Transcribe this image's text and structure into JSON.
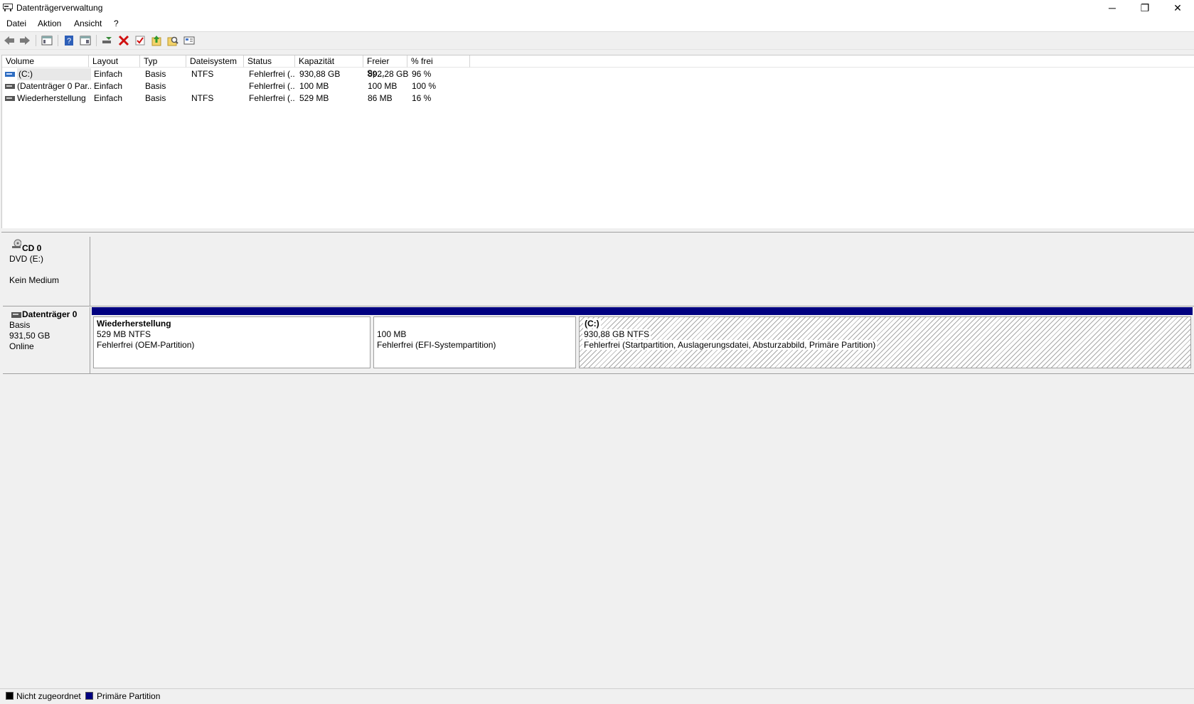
{
  "window": {
    "title": "Datenträgerverwaltung",
    "minimize": "─",
    "restore": "❐",
    "close": "✕"
  },
  "menu": [
    "Datei",
    "Aktion",
    "Ansicht",
    "?"
  ],
  "toolbar": {
    "icons": [
      "back-icon",
      "forward-icon",
      "console-tree-icon",
      "help-icon",
      "properties-pane-icon",
      "connect-disk-icon",
      "delete-icon",
      "check-icon",
      "export-list-icon",
      "find-icon",
      "view-icon"
    ]
  },
  "colors": {
    "primary_partition": "#000080",
    "unallocated": "#000000"
  },
  "volume_list": {
    "columns": [
      "Volume",
      "Layout",
      "Typ",
      "Dateisystem",
      "Status",
      "Kapazität",
      "Freier Sp...",
      "% frei"
    ],
    "rows": [
      {
        "volume": "(C:)",
        "layout": "Einfach",
        "typ": "Basis",
        "fs": "NTFS",
        "status": "Fehlerfrei (...",
        "kapazitaet": "930,88 GB",
        "frei": "892,28 GB",
        "prozent": "96 %"
      },
      {
        "volume": "(Datenträger 0 Par...",
        "layout": "Einfach",
        "typ": "Basis",
        "fs": "",
        "status": "Fehlerfrei (...",
        "kapazitaet": "100 MB",
        "frei": "100 MB",
        "prozent": "100 %"
      },
      {
        "volume": "Wiederherstellung",
        "layout": "Einfach",
        "typ": "Basis",
        "fs": "NTFS",
        "status": "Fehlerfrei (...",
        "kapazitaet": "529 MB",
        "frei": "86 MB",
        "prozent": "16 %"
      }
    ]
  },
  "disks": {
    "cd0": {
      "name": "CD 0",
      "type": "DVD (E:)",
      "state": "Kein Medium"
    },
    "disk0": {
      "name": "Datenträger 0",
      "type": "Basis",
      "size": "931,50 GB",
      "state": "Online",
      "partitions": [
        {
          "label": "Wiederherstellung",
          "size": "529 MB NTFS",
          "status": "Fehlerfrei (OEM-Partition)"
        },
        {
          "label": "",
          "size": "100 MB",
          "status": "Fehlerfrei (EFI-Systempartition)"
        },
        {
          "label": "(C:)",
          "size": "930,88 GB NTFS",
          "status": "Fehlerfrei (Startpartition, Auslagerungsdatei, Absturzabbild, Primäre Partition)"
        }
      ]
    }
  },
  "legend": [
    "Nicht zugeordnet",
    "Primäre Partition"
  ]
}
